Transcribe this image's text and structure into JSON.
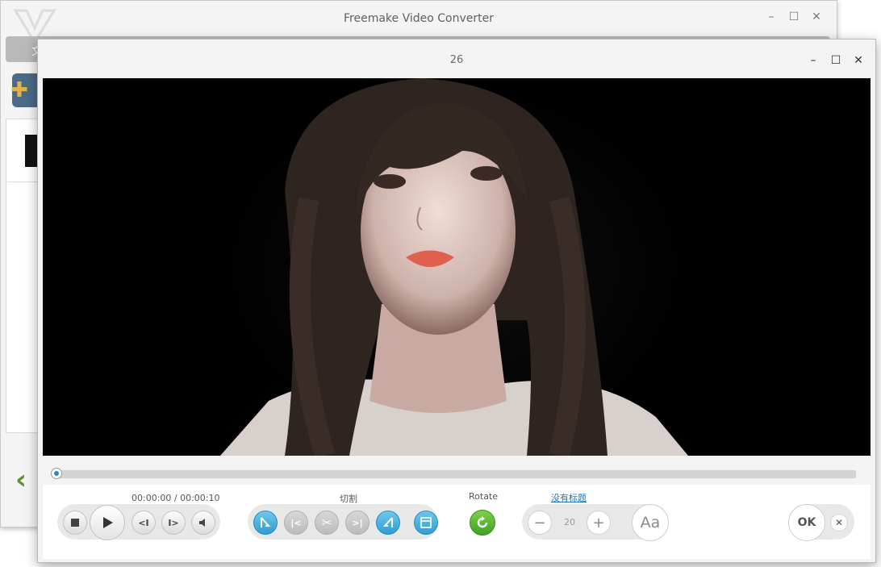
{
  "main_window": {
    "title": "Freemake Video Converter",
    "tab_label": "文"
  },
  "editor": {
    "title": "26"
  },
  "controls": {
    "time": "00:00:00 / 00:00:10",
    "cut_label": "切割",
    "rotate_label": "Rotate",
    "subtitle_label": "没有标题",
    "subtitle_size": "20",
    "font_button": "Aa",
    "ok_label": "OK"
  },
  "progress": 0.0,
  "icons": {
    "stop": "stop-icon",
    "play": "play-icon",
    "prev_frame": "prev-frame-icon",
    "next_frame": "next-frame-icon",
    "volume": "volume-icon",
    "cut": "cut-icon",
    "rotate": "rotate-icon",
    "close": "close-icon"
  },
  "colors": {
    "accent_blue": "#2f9ed3",
    "rotate_green": "#4caf2a",
    "link_blue": "#1e78b4"
  }
}
